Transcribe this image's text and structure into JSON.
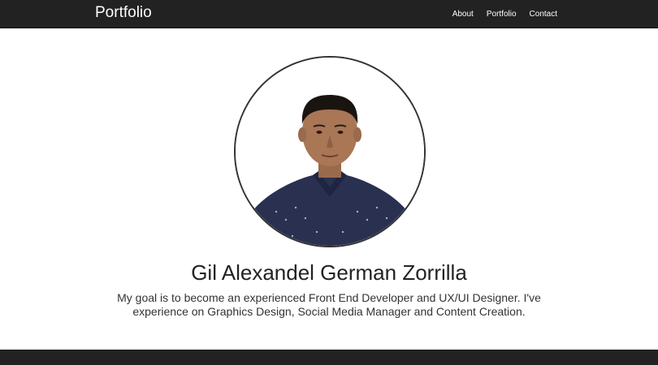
{
  "navbar": {
    "brand": "Portfolio",
    "links": [
      "About",
      "Portfolio",
      "Contact"
    ]
  },
  "profile": {
    "name": "Gil Alexandel German Zorrilla",
    "bio": "My goal is to become an experienced Front End Developer and UX/UI Designer. I've experience on Graphics Design, Social Media Manager and Content Creation."
  },
  "colors": {
    "navbar_bg": "#222222",
    "footer_bg": "#222222",
    "shirt": "#2a3050"
  }
}
